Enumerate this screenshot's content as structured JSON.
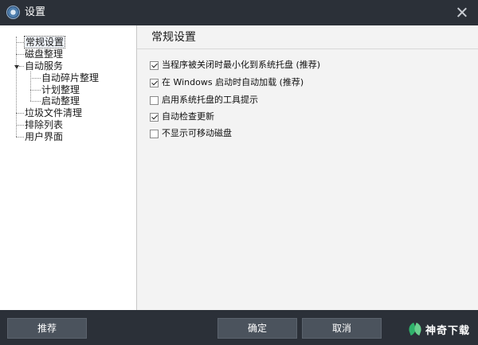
{
  "window": {
    "title": "设置",
    "app_icon": "app-logo-icon",
    "close_icon": "close-icon"
  },
  "sidebar": {
    "items": [
      {
        "label": "常规设置",
        "selected": true
      },
      {
        "label": "磁盘整理"
      },
      {
        "label": "自动服务",
        "expanded": true
      },
      {
        "label": "自动碎片整理"
      },
      {
        "label": "计划整理"
      },
      {
        "label": "启动整理"
      },
      {
        "label": "垃圾文件清理"
      },
      {
        "label": "排除列表"
      },
      {
        "label": "用户界面"
      }
    ]
  },
  "main": {
    "title": "常规设置",
    "options": [
      {
        "label": "当程序被关闭时最小化到系统托盘 (推荐)",
        "checked": true
      },
      {
        "label": "在 Windows 启动时自动加载 (推荐)",
        "checked": true
      },
      {
        "label": "启用系统托盘的工具提示",
        "checked": false
      },
      {
        "label": "自动检查更新",
        "checked": true
      },
      {
        "label": "不显示可移动磁盘",
        "checked": false
      }
    ]
  },
  "footer": {
    "recommend_label": "推荐",
    "ok_label": "确定",
    "cancel_label": "取消"
  },
  "watermark": {
    "text": "神奇下载",
    "color": "#2fb36b"
  },
  "colors": {
    "chrome": "#2b3038",
    "button": "#4b535d",
    "panel": "#f3f3f3"
  }
}
